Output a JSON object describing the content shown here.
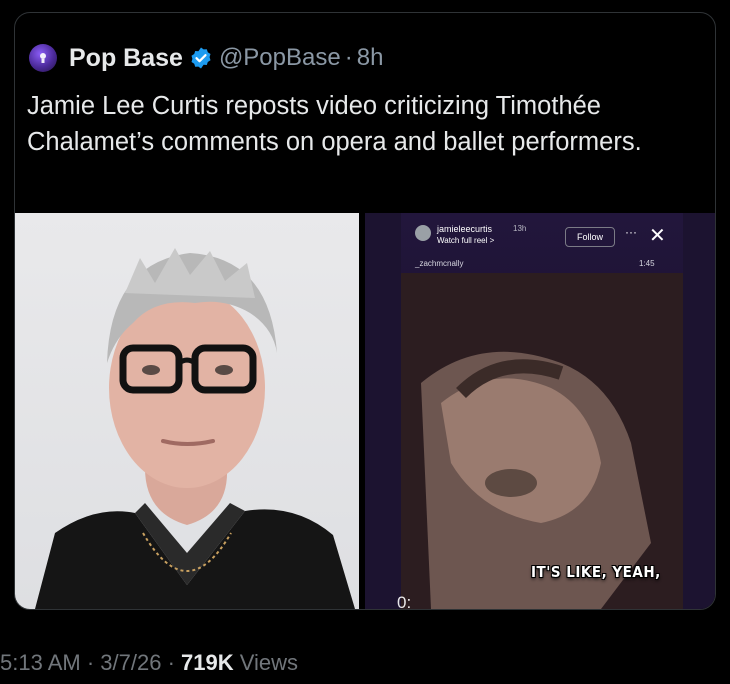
{
  "account": {
    "name": "Pop Base",
    "handle": "@PopBase",
    "separator": "·",
    "age": "8h"
  },
  "tweet": {
    "text": "Jamie Lee Curtis reposts video criticizing Timothée Chalamet’s comments on opera and ballet performers."
  },
  "media": {
    "reel": {
      "user": "jamieleecurtis",
      "posted": "13h",
      "watch_label": "Watch full reel >",
      "follow_label": "Follow",
      "more": "···",
      "close": "✕",
      "original_user": "_zachmcnally",
      "duration": "1:45",
      "caption": "IT'S LIKE, YEAH,",
      "video_time": "0:"
    }
  },
  "footer": {
    "time": "5:13 AM",
    "date": "3/7/26",
    "sep": "·",
    "views_count": "719K",
    "views_label": "Views"
  },
  "colors": {
    "background": "#000000",
    "text": "#e7e9ea",
    "muted": "#71767b",
    "verified": "#1d9bf0"
  }
}
